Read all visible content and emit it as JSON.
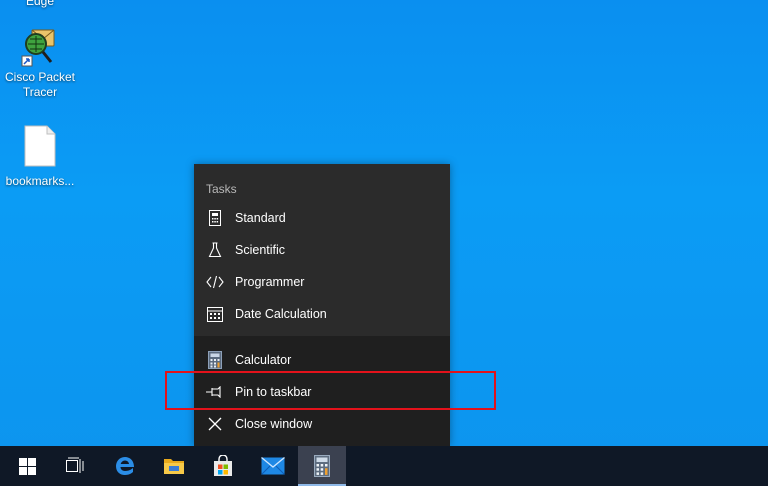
{
  "desktop": {
    "icons": [
      {
        "label": "Edge"
      },
      {
        "label": "Cisco Packet Tracer"
      },
      {
        "label": "bookmarks..."
      }
    ]
  },
  "jumplist": {
    "tasks_header": "Tasks",
    "tasks": [
      {
        "label": "Standard",
        "icon": "calculator-icon"
      },
      {
        "label": "Scientific",
        "icon": "flask-icon"
      },
      {
        "label": "Programmer",
        "icon": "code-icon"
      },
      {
        "label": "Date Calculation",
        "icon": "calendar-icon"
      }
    ],
    "actions": [
      {
        "label": "Calculator",
        "icon": "calculator-app-icon"
      },
      {
        "label": "Pin to taskbar",
        "icon": "pin-icon"
      },
      {
        "label": "Close window",
        "icon": "close-icon"
      }
    ]
  },
  "highlight": {
    "color": "#e3121b",
    "target": "Pin to taskbar"
  },
  "taskbar": {
    "items": [
      "start-icon",
      "task-view-icon",
      "edge-icon",
      "file-explorer-icon",
      "store-icon",
      "mail-icon",
      "calculator-icon"
    ],
    "active": "calculator-icon"
  },
  "colors": {
    "desktop": "#0b9cf5",
    "jumplist_top": "#2b2b2b",
    "jumplist_bottom": "#1f1f1f",
    "taskbar": "#0f1826"
  }
}
